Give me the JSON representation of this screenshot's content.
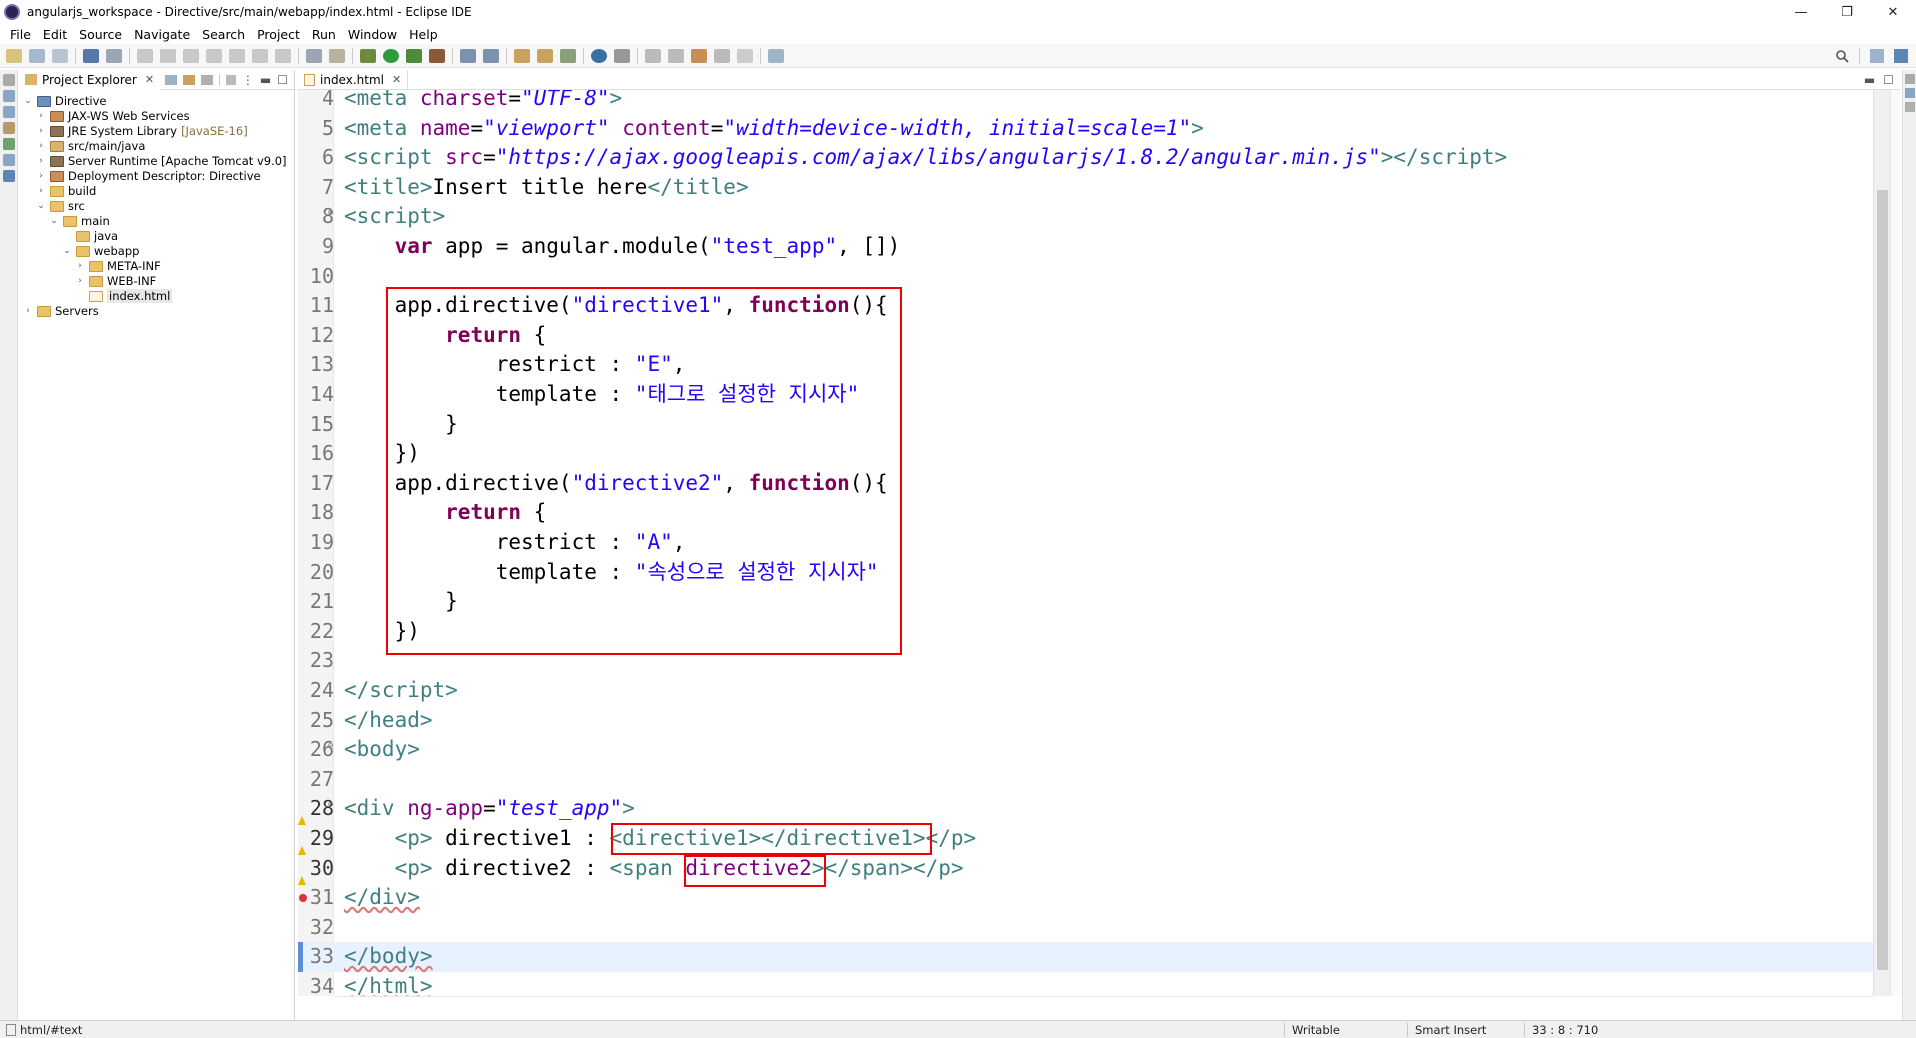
{
  "window": {
    "title": "angularjs_workspace - Directive/src/main/webapp/index.html - Eclipse IDE",
    "minimize": "—",
    "restore": "❐",
    "close": "✕"
  },
  "menu": [
    "File",
    "Edit",
    "Source",
    "Navigate",
    "Search",
    "Project",
    "Run",
    "Window",
    "Help"
  ],
  "explorer": {
    "tab_label": "Project Explorer",
    "tree": [
      {
        "label": "Directive",
        "depth": 0,
        "chev": "v",
        "icon": "proj"
      },
      {
        "label": "JAX-WS Web Services",
        "depth": 1,
        "chev": ">",
        "icon": "srv"
      },
      {
        "label": "JRE System Library",
        "suffix": "[JavaSE-16]",
        "depth": 1,
        "chev": ">",
        "icon": "jar"
      },
      {
        "label": "src/main/java",
        "depth": 1,
        "chev": ">",
        "icon": "pkg"
      },
      {
        "label": "Server Runtime [Apache Tomcat v9.0]",
        "depth": 1,
        "chev": ">",
        "icon": "jar"
      },
      {
        "label": "Deployment Descriptor: Directive",
        "depth": 1,
        "chev": ">",
        "icon": "srv"
      },
      {
        "label": "build",
        "depth": 1,
        "chev": ">",
        "icon": "folder"
      },
      {
        "label": "src",
        "depth": 1,
        "chev": "v",
        "icon": "folder"
      },
      {
        "label": "main",
        "depth": 2,
        "chev": "v",
        "icon": "folder"
      },
      {
        "label": "java",
        "depth": 3,
        "chev": "",
        "icon": "folder"
      },
      {
        "label": "webapp",
        "depth": 3,
        "chev": "v",
        "icon": "folder"
      },
      {
        "label": "META-INF",
        "depth": 4,
        "chev": ">",
        "icon": "folder"
      },
      {
        "label": "WEB-INF",
        "depth": 4,
        "chev": ">",
        "icon": "folder"
      },
      {
        "label": "index.html",
        "depth": 4,
        "chev": "",
        "icon": "file",
        "selected": true
      },
      {
        "label": "Servers",
        "depth": 0,
        "chev": ">",
        "icon": "folder"
      }
    ]
  },
  "editor": {
    "tab_label": "index.html",
    "lines": [
      {
        "n": "4",
        "html": "<span class=\"tag\">&lt;meta </span><span class=\"attr\">charset</span><span class=\"txt\">=</span><span class=\"stri\">\"UTF-8\"</span><span class=\"tag\">&gt;</span>"
      },
      {
        "n": "5",
        "html": "<span class=\"tag\">&lt;meta </span><span class=\"attr\">name</span><span class=\"txt\">=</span><span class=\"stri\">\"viewport\"</span><span class=\"tag\"> </span><span class=\"attr\">content</span><span class=\"txt\">=</span><span class=\"stri\">\"width=device-width, initial=scale=1\"</span><span class=\"tag\">&gt;</span>"
      },
      {
        "n": "6",
        "html": "<span class=\"tag\">&lt;script </span><span class=\"attr\">src</span><span class=\"txt\">=</span><span class=\"stri\">\"https://ajax.googleapis.com/ajax/libs/angularjs/1.8.2/angular.min.js\"</span><span class=\"tag\">&gt;&lt;/script&gt;</span>"
      },
      {
        "n": "7",
        "html": "<span class=\"tag\">&lt;title&gt;</span><span class=\"txt\">Insert title here</span><span class=\"tag\">&lt;/title&gt;</span>"
      },
      {
        "n": "8",
        "fold": "⊖",
        "html": "<span class=\"tag\">&lt;script&gt;</span>"
      },
      {
        "n": "9",
        "html": "<span class=\"txt\">    </span><span class=\"kw\">var</span><span class=\"txt\"> app = angular.module(</span><span class=\"str\">\"test_app\"</span><span class=\"txt\">, [])</span>"
      },
      {
        "n": "10",
        "html": ""
      },
      {
        "n": "11",
        "html": "<span class=\"txt\">    app.directive(</span><span class=\"str\">\"directive1\"</span><span class=\"txt\">, </span><span class=\"kw\">function</span><span class=\"txt\">(){</span>"
      },
      {
        "n": "12",
        "html": "<span class=\"txt\">        </span><span class=\"kw\">return</span><span class=\"txt\"> {</span>"
      },
      {
        "n": "13",
        "html": "<span class=\"txt\">            restrict : </span><span class=\"str\">\"E\"</span><span class=\"txt\">,</span>"
      },
      {
        "n": "14",
        "html": "<span class=\"txt\">            template : </span><span class=\"str\">\"태그로 설정한 지시자\"</span>"
      },
      {
        "n": "15",
        "html": "<span class=\"txt\">        }</span>"
      },
      {
        "n": "16",
        "html": "<span class=\"txt\">    })</span>"
      },
      {
        "n": "17",
        "html": "<span class=\"txt\">    app.directive(</span><span class=\"str\">\"directive2\"</span><span class=\"txt\">, </span><span class=\"kw\">function</span><span class=\"txt\">(){</span>"
      },
      {
        "n": "18",
        "html": "<span class=\"txt\">        </span><span class=\"kw\">return</span><span class=\"txt\"> {</span>"
      },
      {
        "n": "19",
        "html": "<span class=\"txt\">            restrict : </span><span class=\"str\">\"A\"</span><span class=\"txt\">,</span>"
      },
      {
        "n": "20",
        "html": "<span class=\"txt\">            template : </span><span class=\"str\">\"속성으로 설정한 지시자\"</span>"
      },
      {
        "n": "21",
        "html": "<span class=\"txt\">        }</span>"
      },
      {
        "n": "22",
        "html": "<span class=\"txt\">    })</span>"
      },
      {
        "n": "23",
        "html": ""
      },
      {
        "n": "24",
        "html": "<span class=\"tag\">&lt;/script&gt;</span>"
      },
      {
        "n": "25",
        "html": "<span class=\"tag\">&lt;/head&gt;</span>"
      },
      {
        "n": "26",
        "fold": "⊖",
        "html": "<span class=\"tag\">&lt;body&gt;</span>"
      },
      {
        "n": "27",
        "html": ""
      },
      {
        "n": "28",
        "fold": "⊖",
        "marker": "warn",
        "html": "<span class=\"tag\">&lt;div </span><span class=\"attr\">ng-app</span><span class=\"txt\">=</span><span class=\"stri\">\"test_app\"</span><span class=\"tag\">&gt;</span>"
      },
      {
        "n": "29",
        "marker": "warn",
        "html": "<span class=\"txt\">    </span><span class=\"tag\">&lt;p&gt;</span><span class=\"txt\"> directive1 : </span><span class=\"tag\">&lt;directive1&gt;&lt;/directive1&gt;&lt;/p&gt;</span>"
      },
      {
        "n": "30",
        "marker": "warn",
        "html": "<span class=\"txt\">    </span><span class=\"tag\">&lt;p&gt;</span><span class=\"txt\"> directive2 : </span><span class=\"tag\">&lt;span </span><span class=\"attr\">directive2</span><span class=\"tag\">&gt;&lt;/span&gt;&lt;/p&gt;</span>"
      },
      {
        "n": "31",
        "marker": "error",
        "html": "<span class=\"tag squiggle\">&lt;/div&gt;</span>"
      },
      {
        "n": "32",
        "html": ""
      },
      {
        "n": "33",
        "current": true,
        "html": "<span class=\"tag squiggle\">&lt;/body&gt;</span>"
      },
      {
        "n": "34",
        "html": "<span class=\"tag squiggle\">&lt;/html&gt;</span>"
      }
    ]
  },
  "status": {
    "path": "html/#text",
    "writable": "Writable",
    "insert_mode": "Smart Insert",
    "position": "33 : 8 : 710"
  },
  "colors": {
    "highlight_box": "#e00000",
    "current_line": "#e8f2fe",
    "tag": "#3f7f7f",
    "attribute": "#7f007f",
    "string": "#2a00ff",
    "keyword": "#7f0055"
  }
}
